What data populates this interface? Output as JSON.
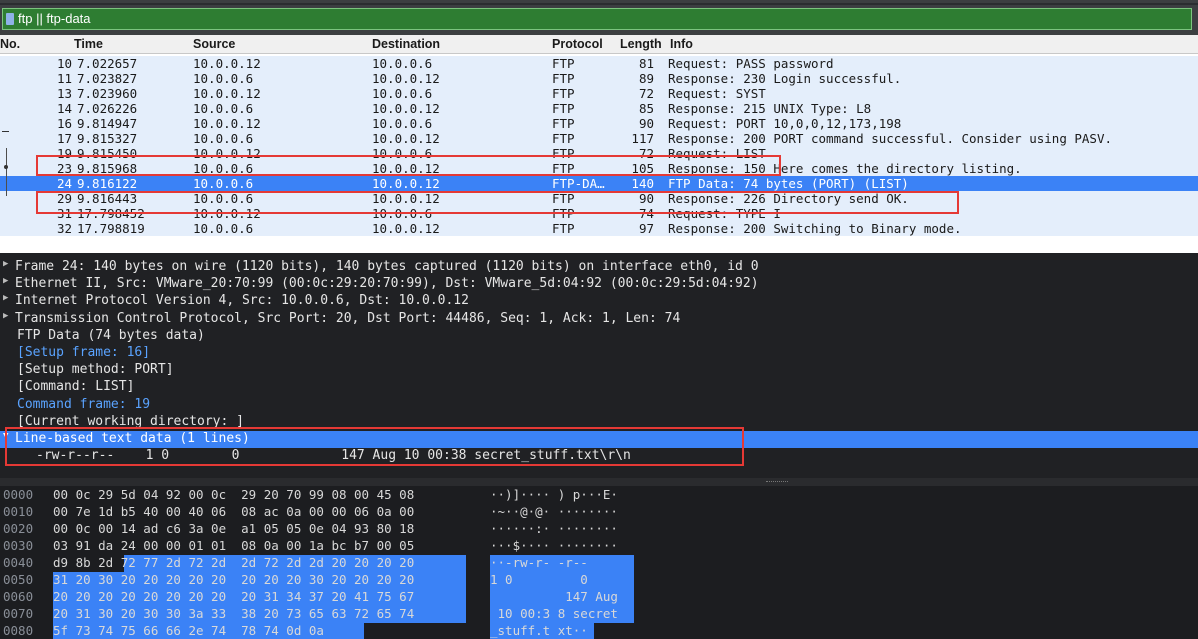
{
  "filter": {
    "text": "ftp || ftp-data",
    "icon": "bookmark-icon"
  },
  "columns": [
    "No.",
    "Time",
    "Source",
    "Destination",
    "Protocol",
    "Length",
    "Info"
  ],
  "packets": [
    {
      "no": "10",
      "time": "7.022657",
      "src": "10.0.0.12",
      "dst": "10.0.0.6",
      "proto": "FTP",
      "len": "81",
      "info": "Request: PASS password"
    },
    {
      "no": "11",
      "time": "7.023827",
      "src": "10.0.0.6",
      "dst": "10.0.0.12",
      "proto": "FTP",
      "len": "89",
      "info": "Response: 230 Login successful."
    },
    {
      "no": "13",
      "time": "7.023960",
      "src": "10.0.0.12",
      "dst": "10.0.0.6",
      "proto": "FTP",
      "len": "72",
      "info": "Request: SYST"
    },
    {
      "no": "14",
      "time": "7.026226",
      "src": "10.0.0.6",
      "dst": "10.0.0.12",
      "proto": "FTP",
      "len": "85",
      "info": "Response: 215 UNIX Type: L8"
    },
    {
      "no": "16",
      "time": "9.814947",
      "src": "10.0.0.12",
      "dst": "10.0.0.6",
      "proto": "FTP",
      "len": "90",
      "info": "Request: PORT 10,0,0,12,173,198"
    },
    {
      "no": "17",
      "time": "9.815327",
      "src": "10.0.0.6",
      "dst": "10.0.0.12",
      "proto": "FTP",
      "len": "117",
      "info": "Response: 200 PORT command successful. Consider using PASV."
    },
    {
      "no": "19",
      "time": "9.815450",
      "src": "10.0.0.12",
      "dst": "10.0.0.6",
      "proto": "FTP",
      "len": "72",
      "info": "Request: LIST"
    },
    {
      "no": "23",
      "time": "9.815968",
      "src": "10.0.0.6",
      "dst": "10.0.0.12",
      "proto": "FTP",
      "len": "105",
      "info": "Response: 150 Here comes the directory listing."
    },
    {
      "no": "24",
      "time": "9.816122",
      "src": "10.0.0.6",
      "dst": "10.0.0.12",
      "proto": "FTP-DA…",
      "len": "140",
      "info": "FTP Data: 74 bytes (PORT) (LIST)"
    },
    {
      "no": "29",
      "time": "9.816443",
      "src": "10.0.0.6",
      "dst": "10.0.0.12",
      "proto": "FTP",
      "len": "90",
      "info": "Response: 226 Directory send OK."
    },
    {
      "no": "31",
      "time": "17.798452",
      "src": "10.0.0.12",
      "dst": "10.0.0.6",
      "proto": "FTP",
      "len": "74",
      "info": "Request: TYPE I"
    },
    {
      "no": "32",
      "time": "17.798819",
      "src": "10.0.0.6",
      "dst": "10.0.0.12",
      "proto": "FTP",
      "len": "97",
      "info": "Response: 200 Switching to Binary mode."
    }
  ],
  "details": [
    {
      "text": "Frame 24: 140 bytes on wire (1120 bits), 140 bytes captured (1120 bits) on interface eth0, id 0",
      "kind": "collapsed"
    },
    {
      "text": "Ethernet II, Src: VMware_20:70:99 (00:0c:29:20:70:99), Dst: VMware_5d:04:92 (00:0c:29:5d:04:92)",
      "kind": "collapsed"
    },
    {
      "text": "Internet Protocol Version 4, Src: 10.0.0.6, Dst: 10.0.0.12",
      "kind": "collapsed"
    },
    {
      "text": "Transmission Control Protocol, Src Port: 20, Dst Port: 44486, Seq: 1, Ack: 1, Len: 74",
      "kind": "collapsed"
    },
    {
      "text": "FTP Data (74 bytes data)",
      "kind": "plain"
    },
    {
      "text": "[Setup frame: 16]",
      "kind": "link"
    },
    {
      "text": "[Setup method: PORT]",
      "kind": "plain"
    },
    {
      "text": "[Command: LIST]",
      "kind": "plain"
    },
    {
      "text": "Command frame: 19",
      "kind": "link"
    },
    {
      "text": "[Current working directory: ]",
      "kind": "plain"
    },
    {
      "text": "Line-based text data (1 lines)",
      "kind": "expanded-selected"
    },
    {
      "text": "-rw-r--r--    1 0        0             147 Aug 10 00:38 secret_stuff.txt\\r\\n",
      "kind": "plain"
    }
  ],
  "bytes": [
    {
      "offset": "0000",
      "hex": "00 0c 29 5d 04 92 00 0c  29 20 70 99 08 00 45 08",
      "ascii": "··)]···· ) p···E·"
    },
    {
      "offset": "0010",
      "hex": "00 7e 1d b5 40 00 40 06  08 ac 0a 00 00 06 0a 00",
      "ascii": "·~··@·@· ········"
    },
    {
      "offset": "0020",
      "hex": "00 0c 00 14 ad c6 3a 0e  a1 05 05 0e 04 93 80 18",
      "ascii": "······:· ········"
    },
    {
      "offset": "0030",
      "hex": "03 91 da 24 00 00 01 01  08 0a 00 1a bc b7 00 05",
      "ascii": "···$···· ········"
    },
    {
      "offset": "0040",
      "hex": "d9 8b 2d 72 77 2d 72 2d  2d 72 2d 2d 20 20 20 20",
      "ascii": "··-rw-r- -r--    "
    },
    {
      "offset": "0050",
      "hex": "31 20 30 20 20 20 20 20  20 20 20 30 20 20 20 20",
      "ascii": "1 0         0    "
    },
    {
      "offset": "0060",
      "hex": "20 20 20 20 20 20 20 20  20 31 34 37 20 41 75 67",
      "ascii": "          147 Aug"
    },
    {
      "offset": "0070",
      "hex": "20 31 30 20 30 30 3a 33  38 20 73 65 63 72 65 74",
      "ascii": " 10 00:3 8 secret"
    },
    {
      "offset": "0080",
      "hex": "5f 73 74 75 66 66 2e 74  78 74 0d 0a",
      "ascii": "_stuff.t xt··"
    }
  ],
  "colors": {
    "selection": "#3b82f6",
    "annotation": "#e53935",
    "filter_bg": "#2e7d32"
  }
}
